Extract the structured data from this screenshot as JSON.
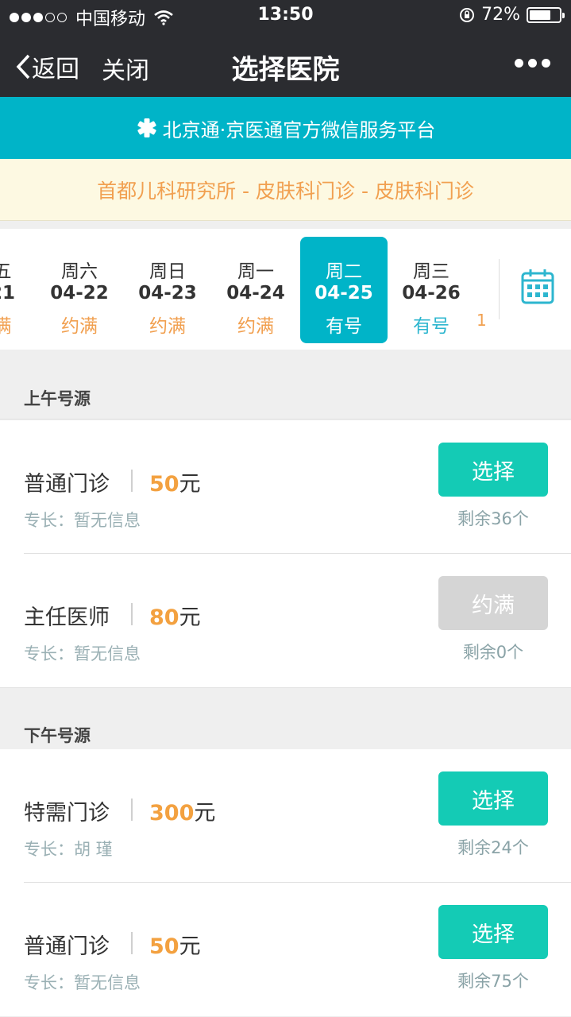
{
  "status": {
    "carrier": "中国移动",
    "time": "13:50",
    "battery": "72%",
    "battery_level": 0.72
  },
  "nav": {
    "back_label": "返回",
    "close_label": "关闭",
    "title": "选择医院"
  },
  "platform_banner": "北京通·京医通官方微信服务平台",
  "notice": "首都儿科研究所 - 皮肤科门诊 - 皮肤科门诊",
  "dates": [
    {
      "weekday": "五",
      "date": "21",
      "status": "满"
    },
    {
      "weekday": "周六",
      "date": "04-22",
      "status": "约满"
    },
    {
      "weekday": "周日",
      "date": "04-23",
      "status": "约满"
    },
    {
      "weekday": "周一",
      "date": "04-24",
      "status": "约满"
    },
    {
      "weekday": "周二",
      "date": "04-25",
      "status": "有号"
    },
    {
      "weekday": "周三",
      "date": "04-26",
      "status": "有号"
    }
  ],
  "dates_extra": "1",
  "morning": {
    "title": "上午号源",
    "slots": [
      {
        "name": "普通门诊",
        "fee_num": "50",
        "fee_unit": "元",
        "spec": "专长：暂无信息",
        "button": "选择",
        "remain": "剩余36个"
      },
      {
        "name": "主任医师",
        "fee_num": "80",
        "fee_unit": "元",
        "spec": "专长：暂无信息",
        "button": "约满",
        "remain": "剩余0个"
      }
    ]
  },
  "afternoon": {
    "title": "下午号源",
    "slots": [
      {
        "name": "特需门诊",
        "fee_num": "300",
        "fee_unit": "元",
        "spec": "专长：胡 瑾",
        "button": "选择",
        "remain": "剩余24个"
      },
      {
        "name": "普通门诊",
        "fee_num": "50",
        "fee_unit": "元",
        "spec": "专长：暂无信息",
        "button": "选择",
        "remain": "剩余75个"
      }
    ]
  },
  "colors": {
    "accent": "#00b4c8",
    "select_button": "#14cbb5",
    "full_button": "#d5d5d5",
    "price": "#f3a140",
    "notice_text": "#f1a050"
  }
}
